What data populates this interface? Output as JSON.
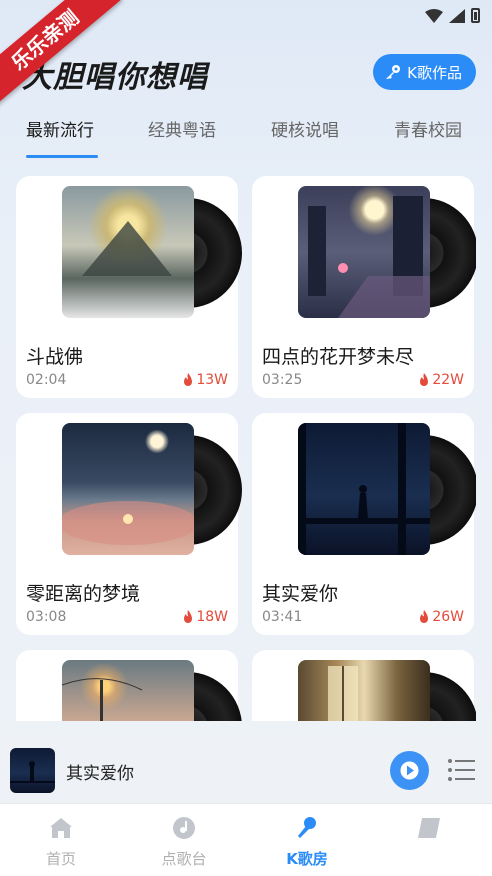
{
  "ribbon": "乐乐亲测",
  "header": {
    "title": "大胆唱你想唱",
    "works_button": "K歌作品"
  },
  "tabs": [
    "最新流行",
    "经典粤语",
    "硬核说唱",
    "青春校园"
  ],
  "songs": [
    {
      "title": "斗战佛",
      "duration": "02:04",
      "plays": "13W"
    },
    {
      "title": "四点的花开梦未尽",
      "duration": "03:25",
      "plays": "22W"
    },
    {
      "title": "零距离的梦境",
      "duration": "03:08",
      "plays": "18W"
    },
    {
      "title": "其实爱你",
      "duration": "03:41",
      "plays": "26W"
    },
    {
      "title": "",
      "duration": "",
      "plays": ""
    },
    {
      "title": "",
      "duration": "",
      "plays": ""
    }
  ],
  "player": {
    "title": "其实爱你"
  },
  "nav": [
    {
      "label": "首页",
      "icon": "home-icon",
      "active": false
    },
    {
      "label": "点歌台",
      "icon": "music-disc-icon",
      "active": false
    },
    {
      "label": "K歌房",
      "icon": "microphone-icon",
      "active": true
    },
    {
      "label": "",
      "icon": "profile-card-icon",
      "active": false
    }
  ],
  "colors": {
    "accent": "#2b8cf7",
    "ribbon": "#d6242c",
    "hot": "#e34b3b"
  }
}
